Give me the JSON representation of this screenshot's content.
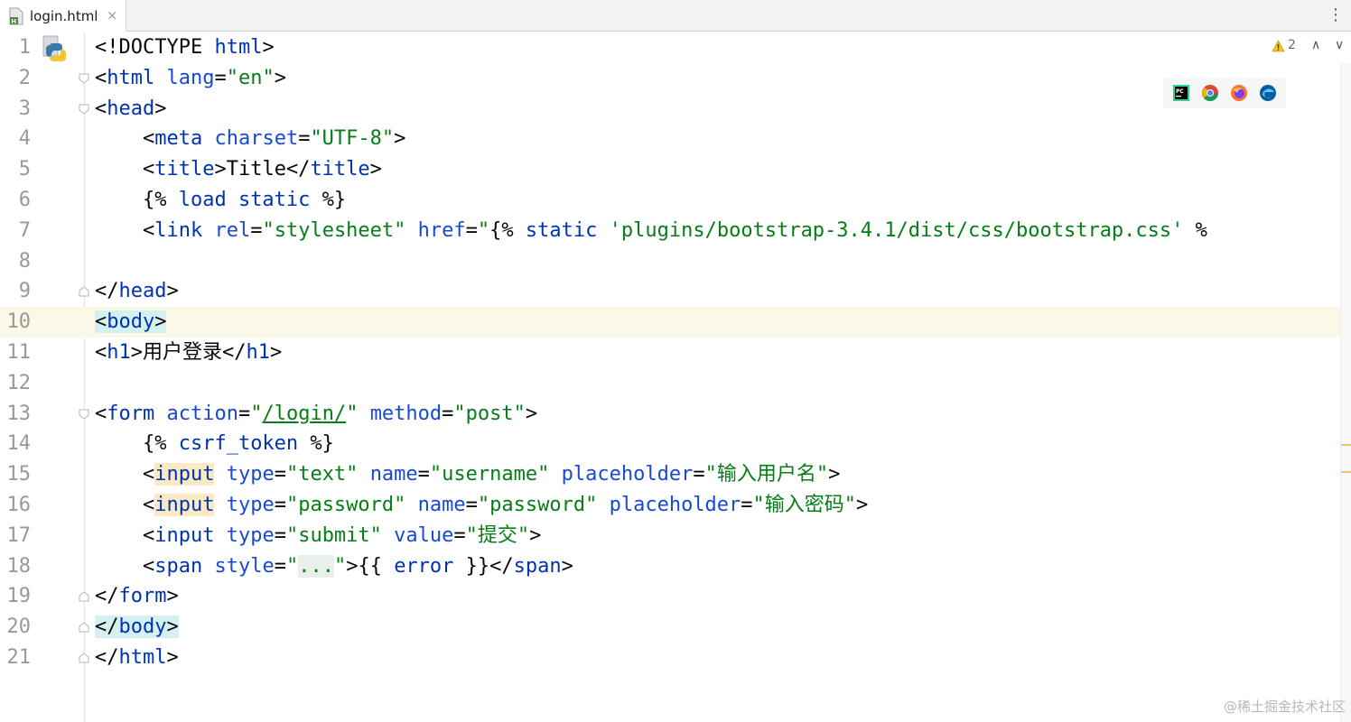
{
  "tab": {
    "filename": "login.html",
    "close": "×",
    "more": "⋮"
  },
  "inspection": {
    "warning_count": "2",
    "up": "∧",
    "down": "∨"
  },
  "browser_icons": [
    "pycharm-icon",
    "chrome-icon",
    "firefox-icon",
    "edge-icon"
  ],
  "colors": {
    "tag": "#0033b3",
    "string": "#067d17",
    "current_line": "#fcf8e7",
    "teal_highlight": "#d4f0f0",
    "warning": "#f0c36d"
  },
  "lines": [
    {
      "n": "1",
      "fold": "",
      "segs": [
        {
          "t": "<!DOCTYPE ",
          "c": ""
        },
        {
          "t": "html",
          "c": "tag"
        },
        {
          "t": ">",
          "c": ""
        }
      ]
    },
    {
      "n": "2",
      "fold": "open",
      "segs": [
        {
          "t": "<",
          "c": ""
        },
        {
          "t": "html",
          "c": "tag"
        },
        {
          "t": " ",
          "c": ""
        },
        {
          "t": "lang",
          "c": "attr"
        },
        {
          "t": "=",
          "c": ""
        },
        {
          "t": "\"en\"",
          "c": "str"
        },
        {
          "t": ">",
          "c": ""
        }
      ]
    },
    {
      "n": "3",
      "fold": "open",
      "segs": [
        {
          "t": "<",
          "c": ""
        },
        {
          "t": "head",
          "c": "tag"
        },
        {
          "t": ">",
          "c": ""
        }
      ]
    },
    {
      "n": "4",
      "fold": "",
      "segs": [
        {
          "t": "    <",
          "c": ""
        },
        {
          "t": "meta",
          "c": "tag"
        },
        {
          "t": " ",
          "c": ""
        },
        {
          "t": "charset",
          "c": "attr"
        },
        {
          "t": "=",
          "c": ""
        },
        {
          "t": "\"UTF-8\"",
          "c": "str"
        },
        {
          "t": ">",
          "c": ""
        }
      ]
    },
    {
      "n": "5",
      "fold": "",
      "segs": [
        {
          "t": "    <",
          "c": ""
        },
        {
          "t": "title",
          "c": "tag"
        },
        {
          "t": ">Title</",
          "c": ""
        },
        {
          "t": "title",
          "c": "tag"
        },
        {
          "t": ">",
          "c": ""
        }
      ]
    },
    {
      "n": "6",
      "fold": "",
      "segs": [
        {
          "t": "    {% ",
          "c": ""
        },
        {
          "t": "load static",
          "c": "tpl"
        },
        {
          "t": " %}",
          "c": ""
        }
      ]
    },
    {
      "n": "7",
      "fold": "",
      "segs": [
        {
          "t": "    <",
          "c": ""
        },
        {
          "t": "link",
          "c": "tag"
        },
        {
          "t": " ",
          "c": ""
        },
        {
          "t": "rel",
          "c": "attr"
        },
        {
          "t": "=",
          "c": ""
        },
        {
          "t": "\"stylesheet\"",
          "c": "str"
        },
        {
          "t": " ",
          "c": ""
        },
        {
          "t": "href",
          "c": "attr"
        },
        {
          "t": "=",
          "c": ""
        },
        {
          "t": "\"",
          "c": "str"
        },
        {
          "t": "{% ",
          "c": ""
        },
        {
          "t": "static",
          "c": "tpl"
        },
        {
          "t": " ",
          "c": ""
        },
        {
          "t": "'plugins/bootstrap-3.4.1/dist/css/bootstrap.css'",
          "c": "str"
        },
        {
          "t": " %",
          "c": ""
        }
      ]
    },
    {
      "n": "8",
      "fold": "",
      "segs": []
    },
    {
      "n": "9",
      "fold": "close",
      "segs": [
        {
          "t": "</",
          "c": ""
        },
        {
          "t": "head",
          "c": "tag"
        },
        {
          "t": ">",
          "c": ""
        }
      ]
    },
    {
      "n": "10",
      "fold": "",
      "current": true,
      "segs": [
        {
          "t": "<",
          "c": "hl-teal"
        },
        {
          "t": "body",
          "c": "tag hl-teal"
        },
        {
          "t": ">",
          "c": "hl-teal"
        }
      ]
    },
    {
      "n": "11",
      "fold": "",
      "segs": [
        {
          "t": "<",
          "c": ""
        },
        {
          "t": "h1",
          "c": "tag"
        },
        {
          "t": ">用户登录</",
          "c": ""
        },
        {
          "t": "h1",
          "c": "tag"
        },
        {
          "t": ">",
          "c": ""
        }
      ]
    },
    {
      "n": "12",
      "fold": "",
      "segs": []
    },
    {
      "n": "13",
      "fold": "open",
      "segs": [
        {
          "t": "<",
          "c": ""
        },
        {
          "t": "form",
          "c": "tag"
        },
        {
          "t": " ",
          "c": ""
        },
        {
          "t": "action",
          "c": "attr"
        },
        {
          "t": "=",
          "c": ""
        },
        {
          "t": "\"",
          "c": "str"
        },
        {
          "t": "/login/",
          "c": "str ul"
        },
        {
          "t": "\"",
          "c": "str"
        },
        {
          "t": " ",
          "c": ""
        },
        {
          "t": "method",
          "c": "attr"
        },
        {
          "t": "=",
          "c": ""
        },
        {
          "t": "\"post\"",
          "c": "str"
        },
        {
          "t": ">",
          "c": ""
        }
      ]
    },
    {
      "n": "14",
      "fold": "",
      "segs": [
        {
          "t": "    {% ",
          "c": ""
        },
        {
          "t": "csrf_token",
          "c": "tpl"
        },
        {
          "t": " %}",
          "c": ""
        }
      ]
    },
    {
      "n": "15",
      "fold": "",
      "segs": [
        {
          "t": "    <",
          "c": ""
        },
        {
          "t": "input",
          "c": "tag hl-warn"
        },
        {
          "t": " ",
          "c": ""
        },
        {
          "t": "type",
          "c": "attr"
        },
        {
          "t": "=",
          "c": ""
        },
        {
          "t": "\"text\"",
          "c": "str"
        },
        {
          "t": " ",
          "c": ""
        },
        {
          "t": "name",
          "c": "attr"
        },
        {
          "t": "=",
          "c": ""
        },
        {
          "t": "\"username\"",
          "c": "str"
        },
        {
          "t": " ",
          "c": ""
        },
        {
          "t": "placeholder",
          "c": "attr"
        },
        {
          "t": "=",
          "c": ""
        },
        {
          "t": "\"输入用户名\"",
          "c": "str"
        },
        {
          "t": ">",
          "c": ""
        }
      ]
    },
    {
      "n": "16",
      "fold": "",
      "segs": [
        {
          "t": "    <",
          "c": ""
        },
        {
          "t": "input",
          "c": "tag hl-warn"
        },
        {
          "t": " ",
          "c": ""
        },
        {
          "t": "type",
          "c": "attr"
        },
        {
          "t": "=",
          "c": ""
        },
        {
          "t": "\"password\"",
          "c": "str"
        },
        {
          "t": " ",
          "c": ""
        },
        {
          "t": "name",
          "c": "attr"
        },
        {
          "t": "=",
          "c": ""
        },
        {
          "t": "\"password\"",
          "c": "str"
        },
        {
          "t": " ",
          "c": ""
        },
        {
          "t": "placeholder",
          "c": "attr"
        },
        {
          "t": "=",
          "c": ""
        },
        {
          "t": "\"输入密码\"",
          "c": "str"
        },
        {
          "t": ">",
          "c": ""
        }
      ]
    },
    {
      "n": "17",
      "fold": "",
      "segs": [
        {
          "t": "    <",
          "c": ""
        },
        {
          "t": "input",
          "c": "tag"
        },
        {
          "t": " ",
          "c": ""
        },
        {
          "t": "type",
          "c": "attr"
        },
        {
          "t": "=",
          "c": ""
        },
        {
          "t": "\"submit\"",
          "c": "str"
        },
        {
          "t": " ",
          "c": ""
        },
        {
          "t": "value",
          "c": "attr"
        },
        {
          "t": "=",
          "c": ""
        },
        {
          "t": "\"提交\"",
          "c": "str"
        },
        {
          "t": ">",
          "c": ""
        }
      ]
    },
    {
      "n": "18",
      "fold": "",
      "segs": [
        {
          "t": "    <",
          "c": ""
        },
        {
          "t": "span",
          "c": "tag"
        },
        {
          "t": " ",
          "c": ""
        },
        {
          "t": "style",
          "c": "attr"
        },
        {
          "t": "=",
          "c": ""
        },
        {
          "t": "\"",
          "c": "str"
        },
        {
          "t": "...",
          "c": "fold-dots"
        },
        {
          "t": "\"",
          "c": "str"
        },
        {
          "t": ">{{ ",
          "c": ""
        },
        {
          "t": "error",
          "c": "tpl"
        },
        {
          "t": " }}</",
          "c": ""
        },
        {
          "t": "span",
          "c": "tag"
        },
        {
          "t": ">",
          "c": ""
        }
      ]
    },
    {
      "n": "19",
      "fold": "close",
      "segs": [
        {
          "t": "</",
          "c": ""
        },
        {
          "t": "form",
          "c": "tag"
        },
        {
          "t": ">",
          "c": ""
        }
      ]
    },
    {
      "n": "20",
      "fold": "close",
      "segs": [
        {
          "t": "</",
          "c": "hl-teal"
        },
        {
          "t": "body",
          "c": "tag hl-teal"
        },
        {
          "t": ">",
          "c": "hl-teal"
        }
      ]
    },
    {
      "n": "21",
      "fold": "close",
      "segs": [
        {
          "t": "</",
          "c": ""
        },
        {
          "t": "html",
          "c": "tag"
        },
        {
          "t": ">",
          "c": ""
        }
      ]
    }
  ],
  "watermark": "@稀土掘金技术社区"
}
